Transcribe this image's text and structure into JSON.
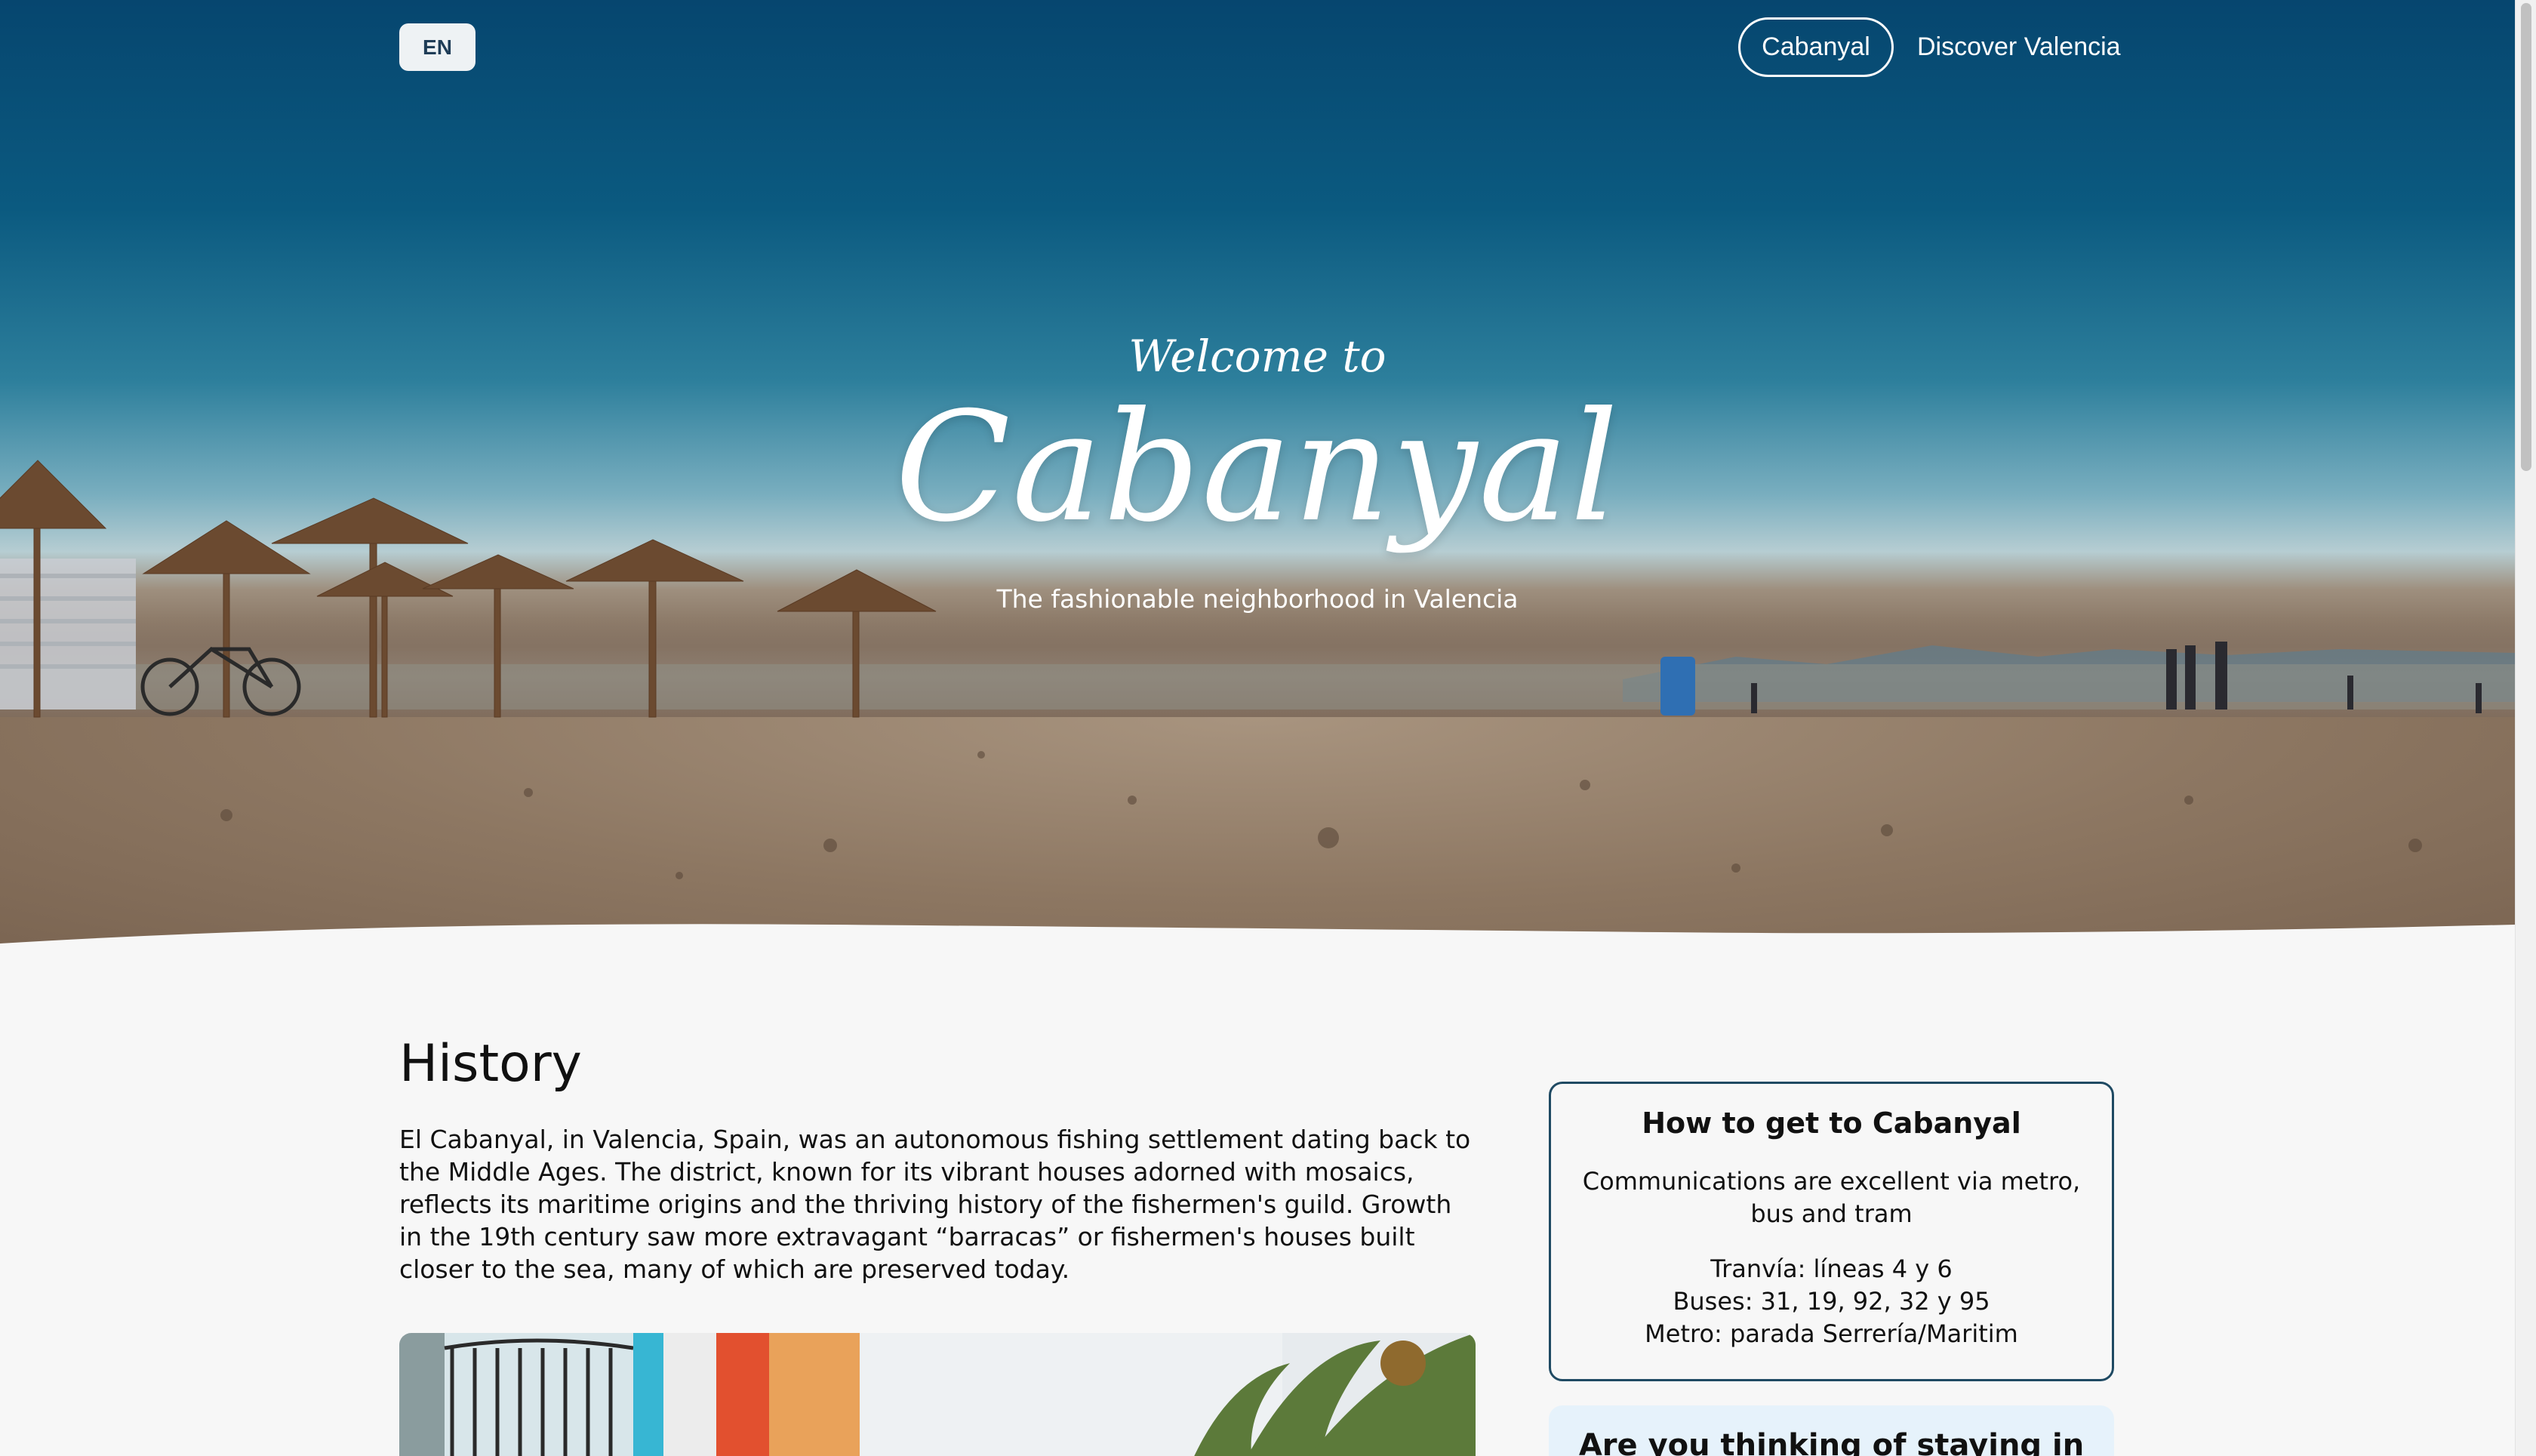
{
  "header": {
    "language": "EN",
    "nav": [
      {
        "label": "Cabanyal",
        "active": true
      },
      {
        "label": "Discover Valencia",
        "active": false
      }
    ]
  },
  "hero": {
    "welcome": "Welcome to",
    "title": "Cabanyal",
    "tagline": "The fashionable neighborhood in Valencia"
  },
  "history": {
    "title": "History",
    "body": "El Cabanyal, in Valencia, Spain, was an autonomous fishing settlement dating back to the Middle Ages. The district, known for its vibrant houses adorned with mosaics, reflects its maritime origins and the thriving history of the fishermen's guild. Growth in the 19th century saw more extravagant “barracas” or fishermen's houses built closer to the sea, many of which are preserved today."
  },
  "transport": {
    "title": "How to get to Cabanyal",
    "intro": "Communications are excellent via metro, bus and tram",
    "lines": [
      "Tranvía: líneas 4 y 6",
      "Buses: 31, 19, 92, 32 y 95",
      "Metro: parada Serrería/Maritim"
    ]
  },
  "stay": {
    "title": "Are you thinking of staying in"
  },
  "colors": {
    "sky": "#06466f",
    "card_border": "#1f4a63",
    "stay_bg": "#e6f2fb",
    "page_bg": "#f7f7f7"
  }
}
